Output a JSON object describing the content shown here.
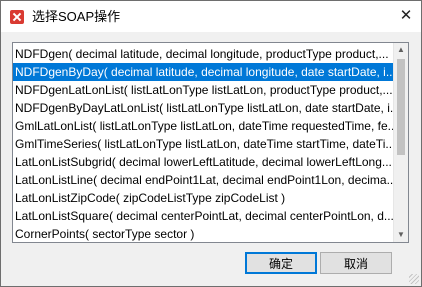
{
  "window": {
    "title": "选择SOAP操作",
    "close_glyph": "✕"
  },
  "operations": {
    "items": [
      "NDFDgen( decimal latitude, decimal longitude, productType product,...",
      "NDFDgenByDay( decimal latitude, decimal longitude, date startDate, i...",
      "NDFDgenLatLonList( listLatLonType listLatLon, productType product,...",
      "NDFDgenByDayLatLonList( listLatLonType listLatLon, date startDate, i...",
      "GmlLatLonList( listLatLonType listLatLon, dateTime requestedTime, fe...",
      "GmlTimeSeries( listLatLonType listLatLon, dateTime startTime, dateTi...",
      "LatLonListSubgrid( decimal lowerLeftLatitude, decimal lowerLeftLong...",
      "LatLonListLine( decimal endPoint1Lat, decimal endPoint1Lon, decima...",
      "LatLonListZipCode( zipCodeListType zipCodeList )",
      "LatLonListSquare( decimal centerPointLat, decimal centerPointLon, d...",
      "CornerPoints( sectorType sector )"
    ],
    "selected_index": 1
  },
  "buttons": {
    "ok_label": "确定",
    "cancel_label": "取消"
  },
  "colors": {
    "selection": "#0078d7",
    "app_icon": "#d93a32"
  }
}
